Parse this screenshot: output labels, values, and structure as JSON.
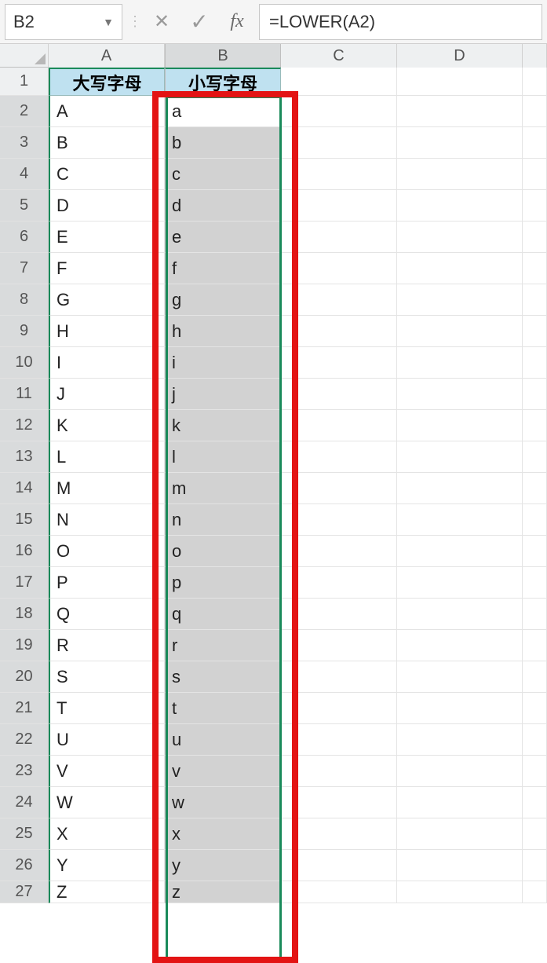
{
  "formula_bar": {
    "name_box": "B2",
    "formula": "=LOWER(A2)",
    "fx_label": "fx"
  },
  "columns": [
    "A",
    "B",
    "C",
    "D"
  ],
  "headers": {
    "A": "大写字母",
    "B": "小写字母"
  },
  "rows": [
    {
      "n": 1
    },
    {
      "n": 2,
      "A": "A",
      "B": "a"
    },
    {
      "n": 3,
      "A": "B",
      "B": "b"
    },
    {
      "n": 4,
      "A": "C",
      "B": "c"
    },
    {
      "n": 5,
      "A": "D",
      "B": "d"
    },
    {
      "n": 6,
      "A": "E",
      "B": "e"
    },
    {
      "n": 7,
      "A": "F",
      "B": "f"
    },
    {
      "n": 8,
      "A": "G",
      "B": "g"
    },
    {
      "n": 9,
      "A": "H",
      "B": "h"
    },
    {
      "n": 10,
      "A": "I",
      "B": "i"
    },
    {
      "n": 11,
      "A": "J",
      "B": "j"
    },
    {
      "n": 12,
      "A": "K",
      "B": "k"
    },
    {
      "n": 13,
      "A": "L",
      "B": "l"
    },
    {
      "n": 14,
      "A": "M",
      "B": "m"
    },
    {
      "n": 15,
      "A": "N",
      "B": "n"
    },
    {
      "n": 16,
      "A": "O",
      "B": "o"
    },
    {
      "n": 17,
      "A": "P",
      "B": "p"
    },
    {
      "n": 18,
      "A": "Q",
      "B": "q"
    },
    {
      "n": 19,
      "A": "R",
      "B": "r"
    },
    {
      "n": 20,
      "A": "S",
      "B": "s"
    },
    {
      "n": 21,
      "A": "T",
      "B": "t"
    },
    {
      "n": 22,
      "A": "U",
      "B": "u"
    },
    {
      "n": 23,
      "A": "V",
      "B": "v"
    },
    {
      "n": 24,
      "A": "W",
      "B": "w"
    },
    {
      "n": 25,
      "A": "X",
      "B": "x"
    },
    {
      "n": 26,
      "A": "Y",
      "B": "y"
    },
    {
      "n": 27,
      "A": "Z",
      "B": "z"
    }
  ]
}
